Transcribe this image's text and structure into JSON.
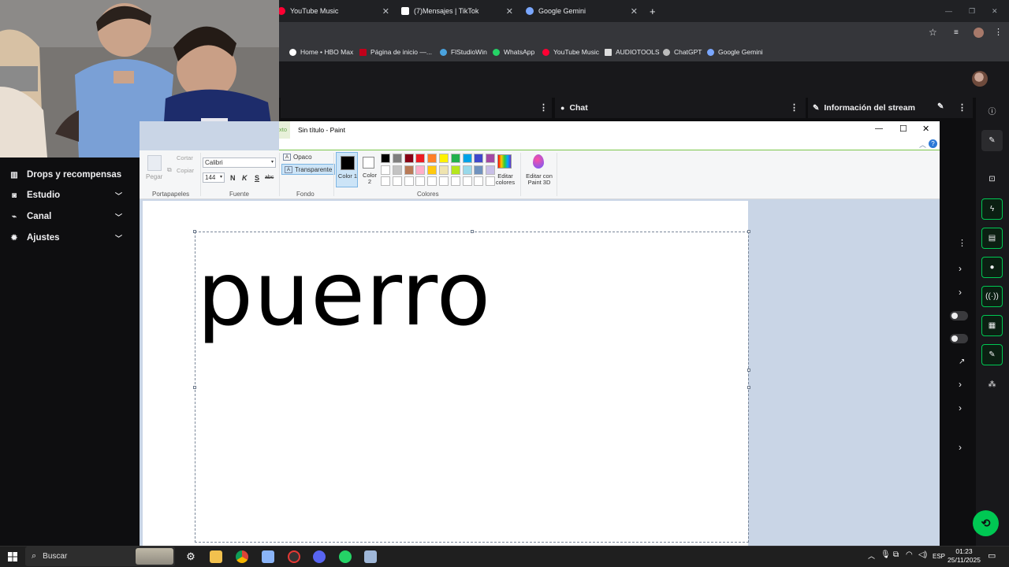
{
  "browser": {
    "tabs": [
      {
        "label": "YouTube Music",
        "icon": "youtube-music-icon"
      },
      {
        "label": "(7)Mensajes | TikTok",
        "icon": "tiktok-icon"
      },
      {
        "label": "Google Gemini",
        "icon": "gemini-icon"
      }
    ],
    "new_tab": "+",
    "close_glyph": "✕",
    "window_controls": [
      "—",
      "❐",
      "✕"
    ],
    "bookmarks": [
      {
        "label": "Home • HBO Max",
        "color": "#ffffff"
      },
      {
        "label": "Página de inicio —...",
        "color": "#c0001a"
      },
      {
        "label": "FlStudioWin",
        "color": "#4aa3df"
      },
      {
        "label": "WhatsApp",
        "color": "#25d366"
      },
      {
        "label": "YouTube Music",
        "color": "#ff0033"
      },
      {
        "label": "AUDIOTOOLS",
        "color": "#dddddd"
      },
      {
        "label": "ChatGPT",
        "color": "#bbbbbb"
      },
      {
        "label": "Google Gemini",
        "color": "#7aa7ff"
      }
    ]
  },
  "twitch": {
    "sidebar": [
      {
        "label": "Drops y recompensas",
        "icon": "drops-icon",
        "chevron": false
      },
      {
        "label": "Estudio",
        "icon": "studio-icon",
        "chevron": true
      },
      {
        "label": "Canal",
        "icon": "channel-icon",
        "chevron": true
      },
      {
        "label": "Ajustes",
        "icon": "settings-icon",
        "chevron": true
      }
    ],
    "panels": {
      "chat": "Chat",
      "stream_info": "Información del stream"
    },
    "accent": "#00c853"
  },
  "paint": {
    "title": "Sin título - Paint",
    "tab_fragment": "xto",
    "ribbon": {
      "paste": "Pegar",
      "cut": "Cortar",
      "copy": "Copiar",
      "clipboard_group": "Portapapeles",
      "font_name": "Calibri",
      "font_size": "144",
      "bold": "N",
      "italic": "K",
      "underline": "S",
      "strike": "abc",
      "font_group": "Fuente",
      "opaque": "Opaco",
      "transparent": "Transparente",
      "background_group": "Fondo",
      "color1": "Color 1",
      "color2": "Color 2",
      "edit_colors": "Editar colores",
      "edit_3d": "Editar con Paint 3D",
      "colors_group": "Colores"
    },
    "palette_row1": [
      "#000000",
      "#7f7f7f",
      "#880015",
      "#ed1c24",
      "#ff7f27",
      "#fff200",
      "#22b14c",
      "#00a2e8",
      "#3f48cc",
      "#a349a4"
    ],
    "palette_row2": [
      "#ffffff",
      "#c3c3c3",
      "#b97a57",
      "#ffaec9",
      "#ffc90e",
      "#efe4b0",
      "#b5e61d",
      "#99d9ea",
      "#7092be",
      "#c8bfe7"
    ],
    "canvas_text": "puerro"
  },
  "taskbar": {
    "search_placeholder": "Buscar",
    "time": "01:23",
    "date": "25/11/2025",
    "lang": "ESP"
  }
}
